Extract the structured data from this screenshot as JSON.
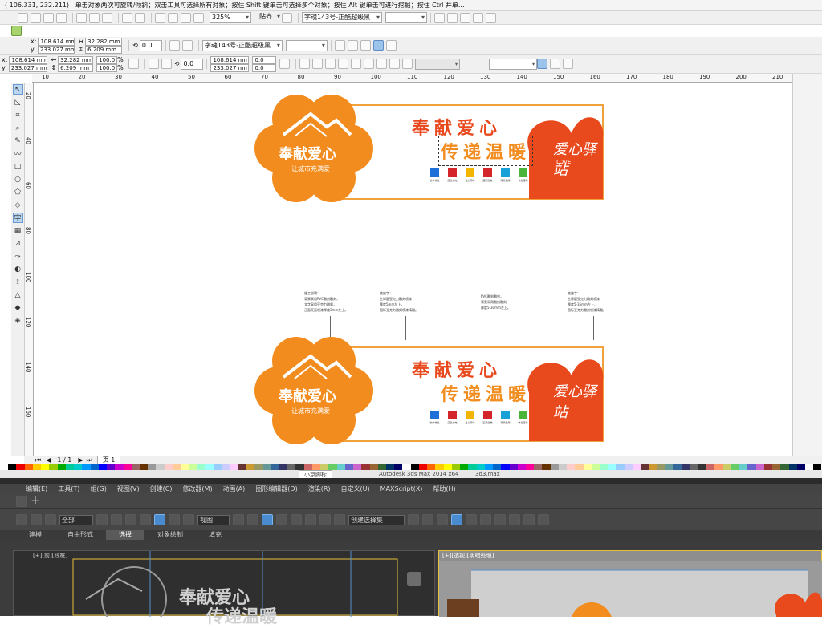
{
  "status": {
    "coords": "( 106.331, 232.211)",
    "hint": "单击对象两次可旋转/倾斜；双击工具可选择所有对象；按住 Shift 键单击可选择多个对象；按住 Alt 键单击可进行挖掘；按住 Ctrl 并单..."
  },
  "toolbar1": {
    "zoom": "325%",
    "snap": "贴齐",
    "font": "字魂143号-正酷超级黑"
  },
  "propbar1": {
    "x": "108.614 mm",
    "y": "233.027 mm",
    "w": "32.282 mm",
    "h": "6.209 mm",
    "angle": "0.0",
    "font": "字魂143号-正酷超级黑"
  },
  "propbar2": {
    "x": "108.614 mm",
    "y": "233.027 mm",
    "w": "32.282 mm",
    "h": "6.209 mm",
    "sx": "100.0",
    "sy": "100.0",
    "pct": "%",
    "angle": "0.0",
    "px": "108.614 mm",
    "py": "233.027 mm",
    "ox": "0.0",
    "oy": "0.0"
  },
  "ruler": {
    "marks": [
      "10",
      "20",
      "30",
      "40",
      "50",
      "60",
      "70",
      "80",
      "90",
      "100",
      "110",
      "120",
      "130",
      "140",
      "150",
      "160",
      "170",
      "180",
      "190",
      "200",
      "210"
    ],
    "vmarks": [
      "20",
      "40",
      "60",
      "80",
      "100",
      "120",
      "140",
      "160"
    ]
  },
  "design": {
    "title1": "奉献爱心",
    "title2": "传递温暖",
    "logo_main": "奉献爱心",
    "logo_sub": "让城市充满爱",
    "heart_text": "爱心驿站",
    "heart_en": "LOVE",
    "icons": [
      {
        "name": "饮水",
        "color": "#1e6fd8"
      },
      {
        "name": "充电",
        "color": "#d4252b"
      },
      {
        "name": "雨伞",
        "color": "#f2b600"
      },
      {
        "name": "药箱",
        "color": "#d4252b"
      },
      {
        "name": "轮椅",
        "color": "#1aa1d8"
      },
      {
        "name": "休息",
        "color": "#4bb43a"
      }
    ],
    "icon_labels": [
      "饮水休息",
      "应急充电",
      "爱心雨伞",
      "医药急救",
      "轮椅借用",
      "休息座椅"
    ],
    "callouts": [
      [
        "施工说明：",
        "背景采用PVC雕刻雕刻，",
        "文字采用亚克力雕刻，",
        "正面亮面喷漆厚度3mm左上。"
      ],
      [
        "底座字：",
        "主标题亚克力雕刻喷漆",
        "厚度5mm左上，",
        "图标亚克力雕刻喷漆精雕。"
      ],
      [
        "PVC雕刻雕刻，",
        "背景采用雕刻雕刻",
        "厚度5-30mm左上。"
      ],
      [
        "底座字：",
        "主标题亚克力雕刻喷漆",
        "厚度5-35mm左上，",
        "图标亚克力雕刻喷漆精雕。"
      ]
    ]
  },
  "pagebar": {
    "page": "1 / 1",
    "tab": "页 1"
  },
  "taskline": {
    "left": "小京脚标",
    "mid": "Autodesk 3ds Max 2014 x64",
    "file": "3d3.max"
  },
  "max": {
    "menu": [
      "编辑(E)",
      "工具(T)",
      "组(G)",
      "视图(V)",
      "创建(C)",
      "修改器(M)",
      "动画(A)",
      "图形编辑器(D)",
      "渲染(R)",
      "自定义(U)",
      "MAXScript(X)",
      "帮助(H)"
    ],
    "filter": "全部",
    "view": "视图",
    "selset": "创建选择集",
    "ribbon": [
      "建模",
      "自由形式",
      "选择",
      "对象绘制",
      "填充"
    ],
    "vp1": "[+][前][线框]",
    "vp2": "[+][透视][明暗处理]",
    "vp_title1": "奉献爱心",
    "vp_title2": "传递温暖"
  },
  "colors": {
    "orange": "#f28c1e",
    "red": "#e8491d",
    "accent": "#4a8bd0"
  }
}
